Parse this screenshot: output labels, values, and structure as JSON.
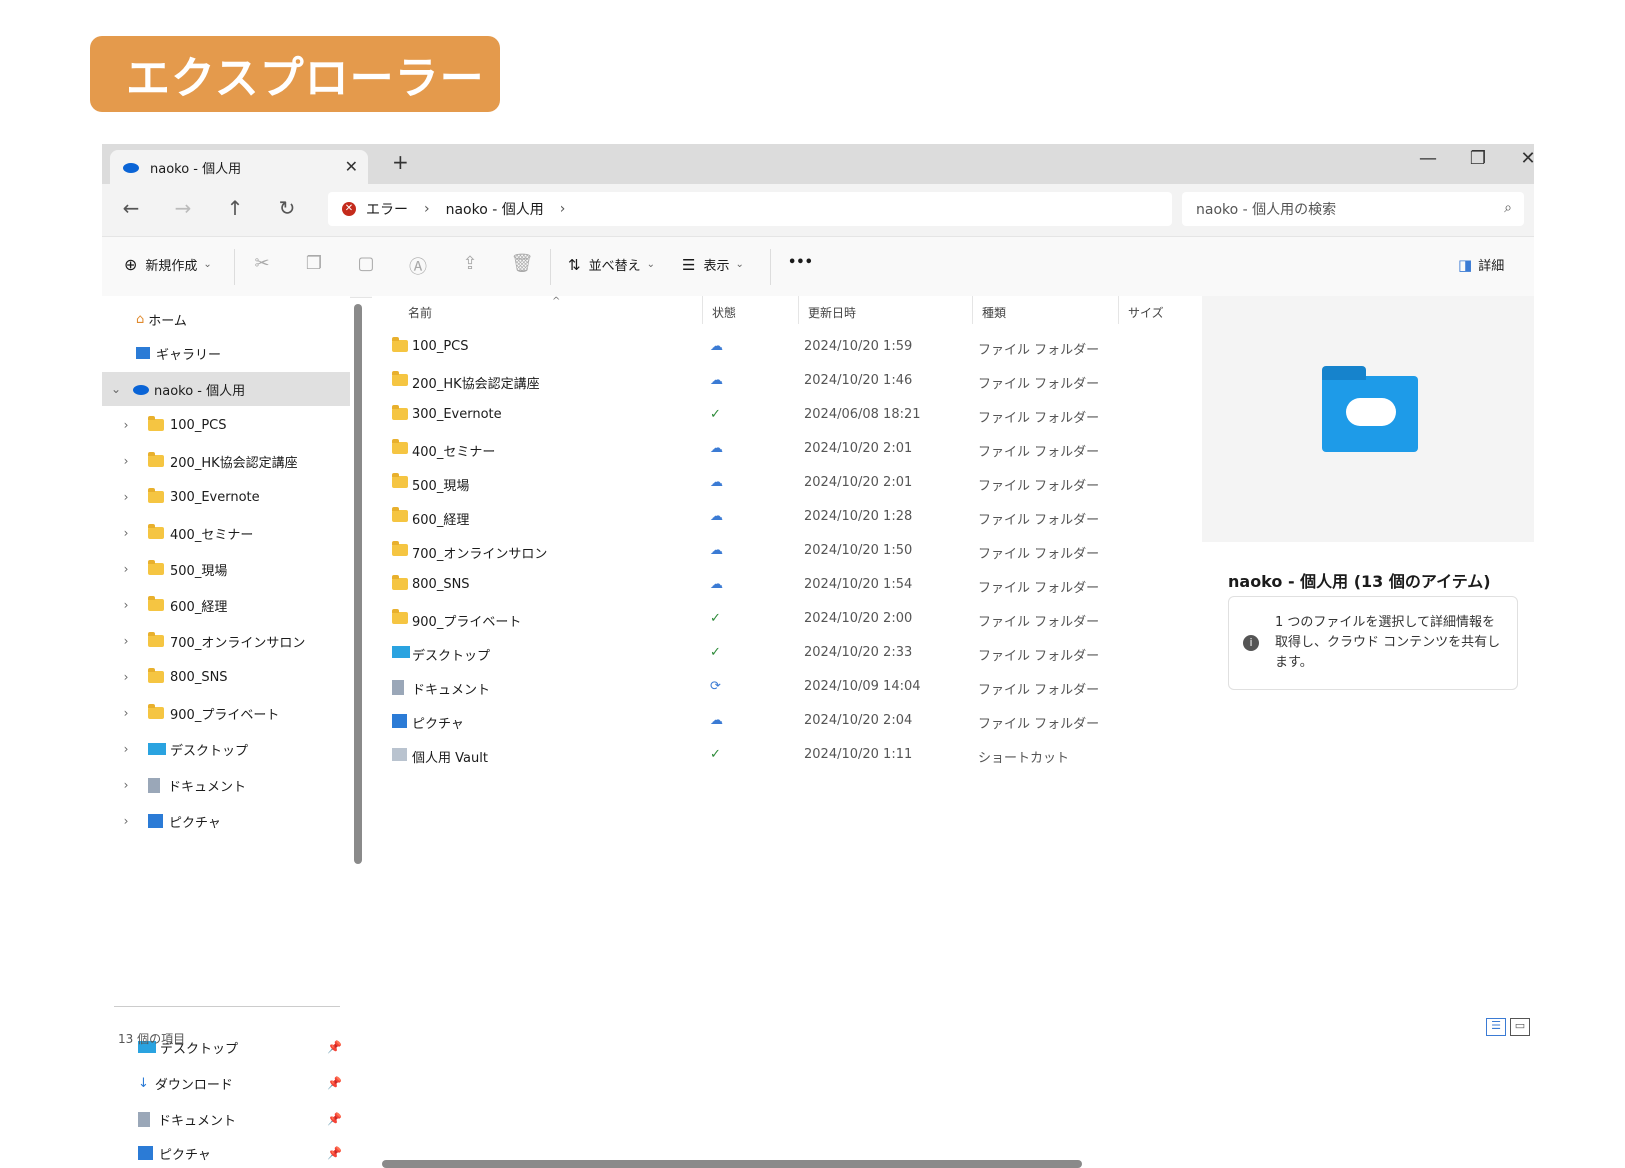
{
  "banner": "エクスプローラー",
  "tab": {
    "title": "naoko - 個人用",
    "close": "✕",
    "new": "+"
  },
  "window_controls": {
    "minimize": "—",
    "maximize": "❐",
    "close": "✕"
  },
  "nav": {
    "back": "←",
    "forward": "→",
    "up": "↑",
    "refresh": "↻"
  },
  "address": {
    "error_label": "エラー",
    "location": "naoko - 個人用",
    "sep": "›"
  },
  "search": {
    "placeholder": "naoko - 個人用の検索",
    "icon": "⌕"
  },
  "toolbar": {
    "new_label": "新規作成",
    "sort_label": "並べ替え",
    "view_label": "表示",
    "more": "•••",
    "details_label": "詳細",
    "icons": [
      "cut-icon",
      "copy-icon",
      "paste-icon",
      "rename-icon",
      "share-icon",
      "delete-icon"
    ]
  },
  "sidebar": {
    "quick": [
      {
        "label": "ホーム",
        "icon": "home-icon"
      },
      {
        "label": "ギャラリー",
        "icon": "gallery-icon"
      }
    ],
    "root": {
      "label": "naoko - 個人用",
      "icon": "onedrive-icon"
    },
    "children": [
      {
        "label": "100_PCS"
      },
      {
        "label": "200_HK協会認定講座"
      },
      {
        "label": "300_Evernote"
      },
      {
        "label": "400_セミナー"
      },
      {
        "label": "500_現場"
      },
      {
        "label": "600_経理"
      },
      {
        "label": "700_オンラインサロン"
      },
      {
        "label": "800_SNS"
      },
      {
        "label": "900_プライベート"
      },
      {
        "label": "デスクトップ"
      },
      {
        "label": "ドキュメント"
      },
      {
        "label": "ピクチャ"
      }
    ],
    "pinned": [
      {
        "label": "デスクトップ",
        "icon": "desktop-icon"
      },
      {
        "label": "ダウンロード",
        "icon": "download-icon"
      },
      {
        "label": "ドキュメント",
        "icon": "document-icon"
      },
      {
        "label": "ピクチャ",
        "icon": "picture-icon"
      }
    ]
  },
  "columns": {
    "name": "名前",
    "status": "状態",
    "modified": "更新日時",
    "type": "種類",
    "size": "サイズ"
  },
  "files": [
    {
      "name": "100_PCS",
      "status": "cloud",
      "date": "2024/10/20 1:59",
      "type": "ファイル フォルダー"
    },
    {
      "name": "200_HK協会認定講座",
      "status": "cloud",
      "date": "2024/10/20 1:46",
      "type": "ファイル フォルダー"
    },
    {
      "name": "300_Evernote",
      "status": "synced",
      "date": "2024/06/08 18:21",
      "type": "ファイル フォルダー"
    },
    {
      "name": "400_セミナー",
      "status": "cloud",
      "date": "2024/10/20 2:01",
      "type": "ファイル フォルダー"
    },
    {
      "name": "500_現場",
      "status": "cloud",
      "date": "2024/10/20 2:01",
      "type": "ファイル フォルダー"
    },
    {
      "name": "600_経理",
      "status": "cloud",
      "date": "2024/10/20 1:28",
      "type": "ファイル フォルダー"
    },
    {
      "name": "700_オンラインサロン",
      "status": "cloud",
      "date": "2024/10/20 1:50",
      "type": "ファイル フォルダー"
    },
    {
      "name": "800_SNS",
      "status": "cloud",
      "date": "2024/10/20 1:54",
      "type": "ファイル フォルダー"
    },
    {
      "name": "900_プライベート",
      "status": "synced",
      "date": "2024/10/20 2:00",
      "type": "ファイル フォルダー"
    },
    {
      "name": "デスクトップ",
      "status": "synced",
      "date": "2024/10/20 2:33",
      "type": "ファイル フォルダー"
    },
    {
      "name": "ドキュメント",
      "status": "syncing",
      "date": "2024/10/09 14:04",
      "type": "ファイル フォルダー"
    },
    {
      "name": "ピクチャ",
      "status": "cloud",
      "date": "2024/10/20 2:04",
      "type": "ファイル フォルダー"
    },
    {
      "name": "個人用 Vault",
      "status": "synced",
      "date": "2024/10/20 1:11",
      "type": "ショートカット"
    }
  ],
  "preview": {
    "title": "naoko - 個人用 (13 個のアイテム)",
    "info": "1 つのファイルを選択して詳細情報を取得し、クラウド コンテンツを共有します。"
  },
  "statusbar": {
    "count": "13 個の項目"
  },
  "colors": {
    "banner": "#e49a4c",
    "folder": "#f5c542",
    "accent": "#3b7bd4"
  }
}
